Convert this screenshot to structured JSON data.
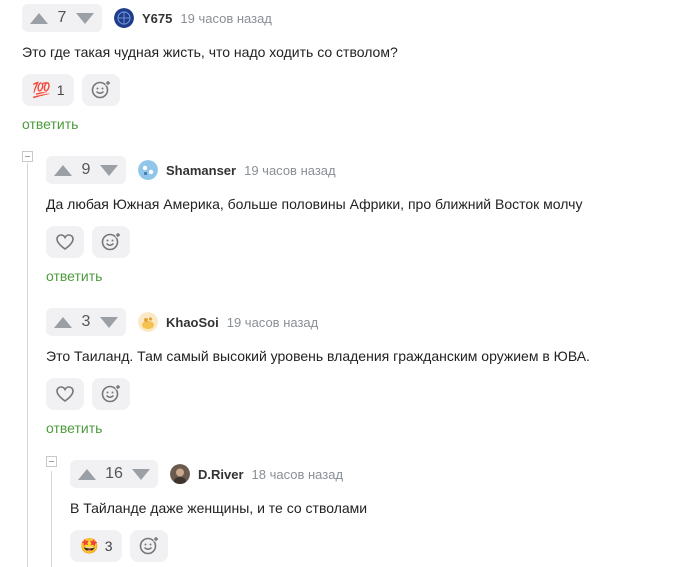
{
  "comments": [
    {
      "rating": "7",
      "author": "Y675",
      "time": "19 часов назад",
      "text": "Это где такая чудная жисть, что надо ходить со стволом?",
      "reaction_emoji": "💯",
      "reaction_count": "1",
      "reply_label": "ответить"
    },
    {
      "rating": "9",
      "author": "Shamanser",
      "time": "19 часов назад",
      "text": "Да любая Южная Америка, больше половины Африки, про ближний Восток молчу",
      "reply_label": "ответить"
    },
    {
      "rating": "3",
      "author": "KhaoSoi",
      "time": "19 часов назад",
      "text": "Это Таиланд. Там самый высокий уровень владения гражданским оружием в ЮВА.",
      "reply_label": "ответить"
    },
    {
      "rating": "16",
      "author": "D.River",
      "time": "18 часов назад",
      "text": "В Тайланде даже женщины, и те со стволами",
      "reaction_emoji": "🤩",
      "reaction_count": "3"
    }
  ],
  "icons": {
    "upvote": "arrow-up-icon",
    "downvote": "arrow-down-icon",
    "like": "heart-icon",
    "add_reaction": "add-emoji-icon",
    "collapse": "collapse-icon"
  },
  "colors": {
    "accent_reply": "#4b9c3b",
    "vote_bg": "#f1f1f3",
    "thread_line": "#d6d6d9"
  }
}
